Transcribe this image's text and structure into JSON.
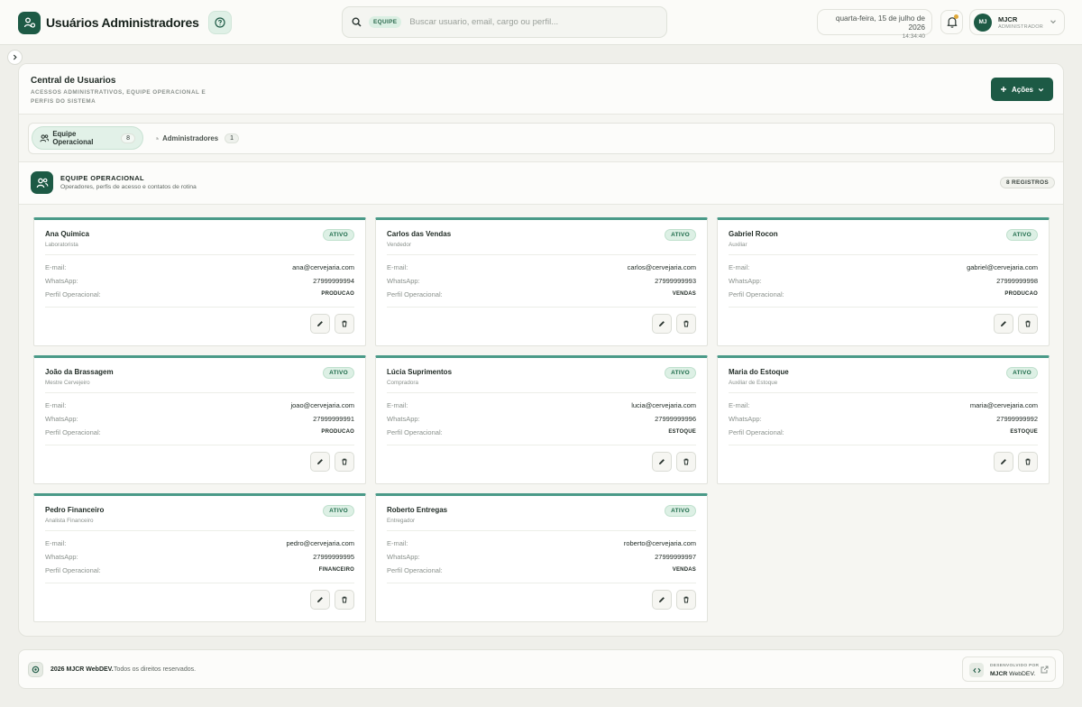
{
  "header": {
    "title": "Usuários Administradores",
    "search_tag": "EQUIPE",
    "search_placeholder": "Buscar usuario, email, cargo ou perfil...",
    "date": "quarta-feira, 15 de julho de 2026",
    "time": "14:34:40",
    "user_initials": "MJ",
    "user_name": "MJCR",
    "user_role": "ADMINISTRADOR"
  },
  "page": {
    "title": "Central de Usuarios",
    "subtitle": "ACESSOS ADMINISTRATIVOS, EQUIPE OPERACIONAL E PERFIS DO SISTEMA",
    "actions_label": "Ações"
  },
  "tabs": [
    {
      "label": "Equipe Operacional",
      "count": "8"
    },
    {
      "label": "Administradores",
      "count": "1"
    }
  ],
  "section": {
    "title": "EQUIPE OPERACIONAL",
    "subtitle": "Operadores, perfis de acesso e contatos de rotina",
    "records": "8 REGISTROS"
  },
  "field_labels": {
    "email": "E-mail:",
    "whatsapp": "WhatsApp:",
    "profile": "Perfil Operacional:"
  },
  "cards": [
    {
      "name": "Ana Quimica",
      "role": "Laboratorista",
      "status": "ATIVO",
      "email": "ana@cervejaria.com",
      "whatsapp": "27999999994",
      "profile": "PRODUCAO"
    },
    {
      "name": "Carlos das Vendas",
      "role": "Vendedor",
      "status": "ATIVO",
      "email": "carlos@cervejaria.com",
      "whatsapp": "27999999993",
      "profile": "VENDAS"
    },
    {
      "name": "Gabriel Rocon",
      "role": "Auxiliar",
      "status": "ATIVO",
      "email": "gabriel@cervejaria.com",
      "whatsapp": "27999999998",
      "profile": "PRODUCAO"
    },
    {
      "name": "João da Brassagem",
      "role": "Mestre Cervejeiro",
      "status": "ATIVO",
      "email": "joao@cervejaria.com",
      "whatsapp": "27999999991",
      "profile": "PRODUCAO"
    },
    {
      "name": "Lúcia Suprimentos",
      "role": "Compradora",
      "status": "ATIVO",
      "email": "lucia@cervejaria.com",
      "whatsapp": "27999999996",
      "profile": "ESTOQUE"
    },
    {
      "name": "Maria do Estoque",
      "role": "Auxiliar de Estoque",
      "status": "ATIVO",
      "email": "maria@cervejaria.com",
      "whatsapp": "27999999992",
      "profile": "ESTOQUE"
    },
    {
      "name": "Pedro Financeiro",
      "role": "Analista Financeiro",
      "status": "ATIVO",
      "email": "pedro@cervejaria.com",
      "whatsapp": "27999999995",
      "profile": "FINANCEIRO"
    },
    {
      "name": "Roberto Entregas",
      "role": "Entregador",
      "status": "ATIVO",
      "email": "roberto@cervejaria.com",
      "whatsapp": "27999999997",
      "profile": "VENDAS"
    }
  ],
  "footer": {
    "brand": "2026 MJCR WebDEV.",
    "rights": "Todos os direitos reservados.",
    "dev_label": "DESENVOLVIDO POR",
    "dev_name": "MJCR",
    "dev_suffix": "WebDEV."
  },
  "colors": {
    "primary": "#1d5a45",
    "accent_border": "#4a9a88",
    "status_bg": "#ddf0e5",
    "notification": "#e0a93a"
  }
}
